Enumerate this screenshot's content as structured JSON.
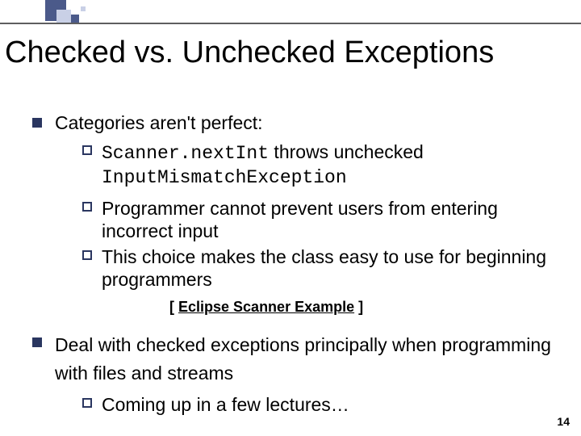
{
  "title": "Checked vs. Unchecked Exceptions",
  "b1": {
    "text": "Categories aren't perfect:",
    "s1a": "Scanner.nextInt",
    "s1b": " throws unchecked ",
    "s1c": "InputMismatchException",
    "s2": "Programmer cannot prevent users from entering incorrect input",
    "s3": "This choice makes the class easy to use for beginning programmers"
  },
  "link": {
    "lb": "[ ",
    "text": "Eclipse Scanner Example",
    "rb": " ]"
  },
  "b2": {
    "text": "Deal with checked exceptions principally when programming with files and streams",
    "s1": "Coming up in a few lectures…"
  },
  "page": "14"
}
